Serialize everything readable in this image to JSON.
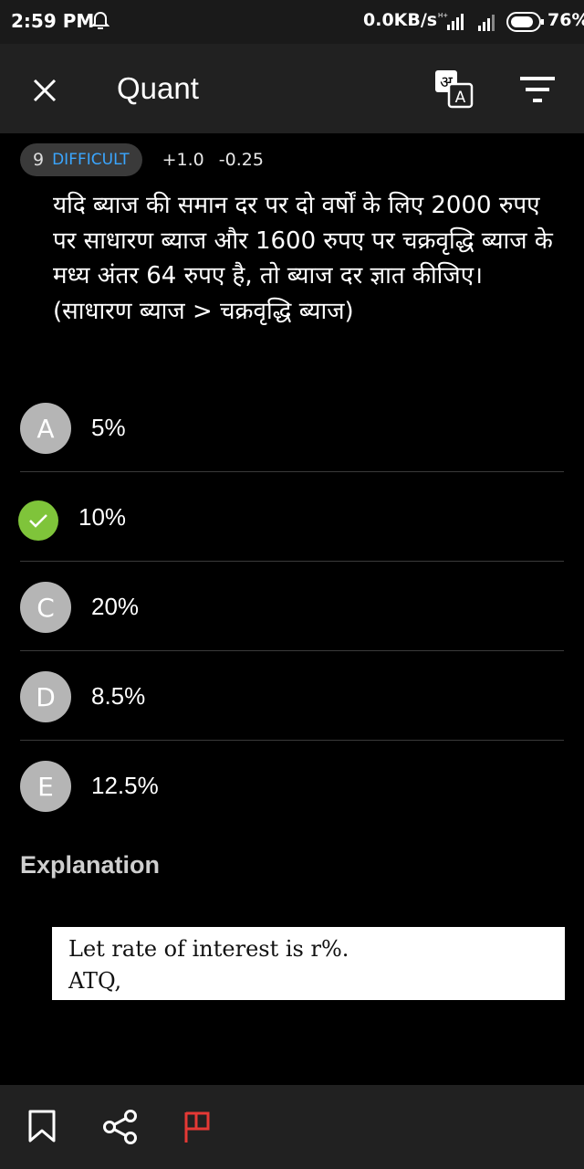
{
  "status_bar": {
    "time": "2:59 PM",
    "network_speed": "0.0KB/s",
    "battery": "76%"
  },
  "header": {
    "title": "Quant"
  },
  "question_meta": {
    "number": "9",
    "difficulty": "DIFFICULT",
    "positive_marks": "+1.0",
    "negative_marks": "-0.25"
  },
  "question": {
    "text": "यदि ब्याज की समान दर पर दो वर्षों के लिए 2000 रुपए पर साधारण ब्याज और 1600 रुपए पर चक्रवृद्धि ब्याज के मध्य अंतर 64 रुपए है, तो ब्याज दर ज्ञात कीजिए।",
    "note": "(साधारण ब्याज > चक्रवृद्धि ब्याज)"
  },
  "options": [
    {
      "letter": "A",
      "value": "5%"
    },
    {
      "letter": "B",
      "value": "10%",
      "correct": true
    },
    {
      "letter": "C",
      "value": "20%"
    },
    {
      "letter": "D",
      "value": "8.5%"
    },
    {
      "letter": "E",
      "value": "12.5%"
    }
  ],
  "explanation": {
    "heading": "Explanation",
    "line1": "Let rate of interest is r%.",
    "line2": "ATQ,"
  },
  "icons": {
    "close": "close-icon",
    "translate": "translate-icon",
    "filter": "filter-icon",
    "bookmark": "bookmark-icon",
    "share": "share-icon",
    "report": "flag-icon",
    "correct": "check-icon"
  },
  "colors": {
    "correct": "#7fc43a",
    "difficulty": "#3aa6ff",
    "flag": "#e53935"
  }
}
